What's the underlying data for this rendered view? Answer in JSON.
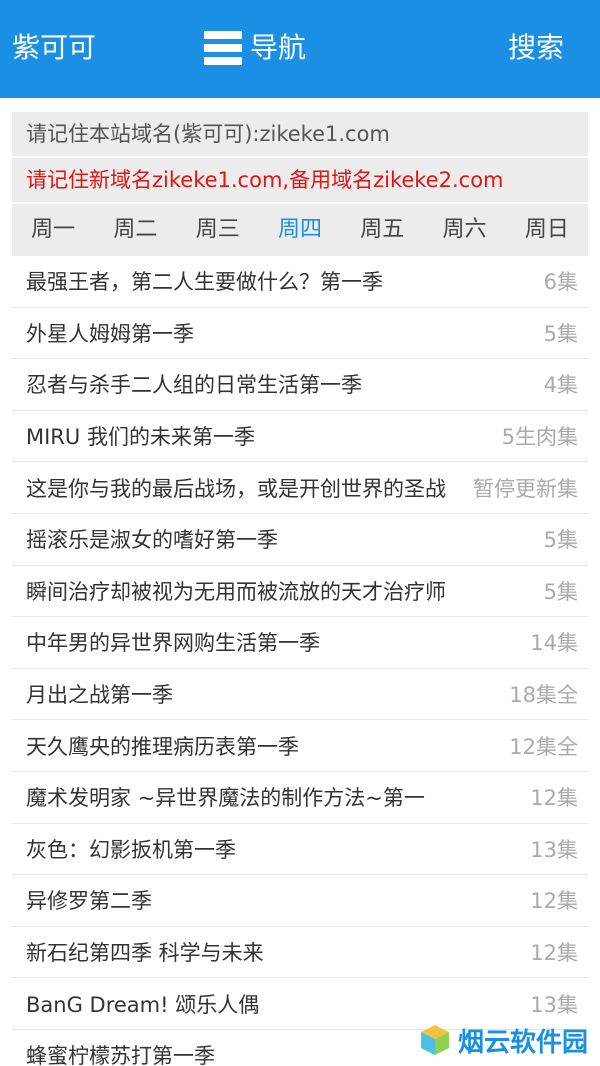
{
  "header": {
    "brand": "紫可可",
    "nav_label": "导航",
    "search_label": "搜索"
  },
  "notices": {
    "domain_tip": "请记住本站域名(紫可可):zikeke1.com",
    "new_domain_tip": "请记住新域名zikeke1.com,备用域名zikeke2.com"
  },
  "days": [
    {
      "label": "周一",
      "active": false
    },
    {
      "label": "周二",
      "active": false
    },
    {
      "label": "周三",
      "active": false
    },
    {
      "label": "周四",
      "active": true
    },
    {
      "label": "周五",
      "active": false
    },
    {
      "label": "周六",
      "active": false
    },
    {
      "label": "周日",
      "active": false
    }
  ],
  "items": [
    {
      "title": "最强王者，第二人生要做什么？第一季",
      "count": "6集"
    },
    {
      "title": "外星人姆姆第一季",
      "count": "5集"
    },
    {
      "title": "忍者与杀手二人组的日常生活第一季",
      "count": "4集"
    },
    {
      "title": "MIRU 我们的未来第一季",
      "count": "5生肉集"
    },
    {
      "title": "这是你与我的最后战场，或是开创世界的圣战",
      "count": "暂停更新集"
    },
    {
      "title": "摇滚乐是淑女的嗜好第一季",
      "count": "5集"
    },
    {
      "title": "瞬间治疗却被视为无用而被流放的天才治疗师",
      "count": "5集"
    },
    {
      "title": "中年男的异世界网购生活第一季",
      "count": "14集"
    },
    {
      "title": "月出之战第一季",
      "count": "18集全"
    },
    {
      "title": "天久鹰央的推理病历表第一季",
      "count": "12集全"
    },
    {
      "title": "魔术发明家 ~异世界魔法的制作方法~第一",
      "count": "12集"
    },
    {
      "title": "灰色：幻影扳机第一季",
      "count": "13集"
    },
    {
      "title": "异修罗第二季",
      "count": "12集"
    },
    {
      "title": "新石纪第四季 科学与未来",
      "count": "12集"
    },
    {
      "title": "BanG Dream! 颂乐人偶",
      "count": "13集"
    },
    {
      "title": "蜂蜜柠檬苏打第一季",
      "count": ""
    }
  ],
  "watermark": {
    "text": "烟云软件园",
    "icon": "cube-logo-icon"
  },
  "colors": {
    "primary": "#1a8fe3",
    "notice_red": "#e01515",
    "bar_gray": "#ececec"
  }
}
